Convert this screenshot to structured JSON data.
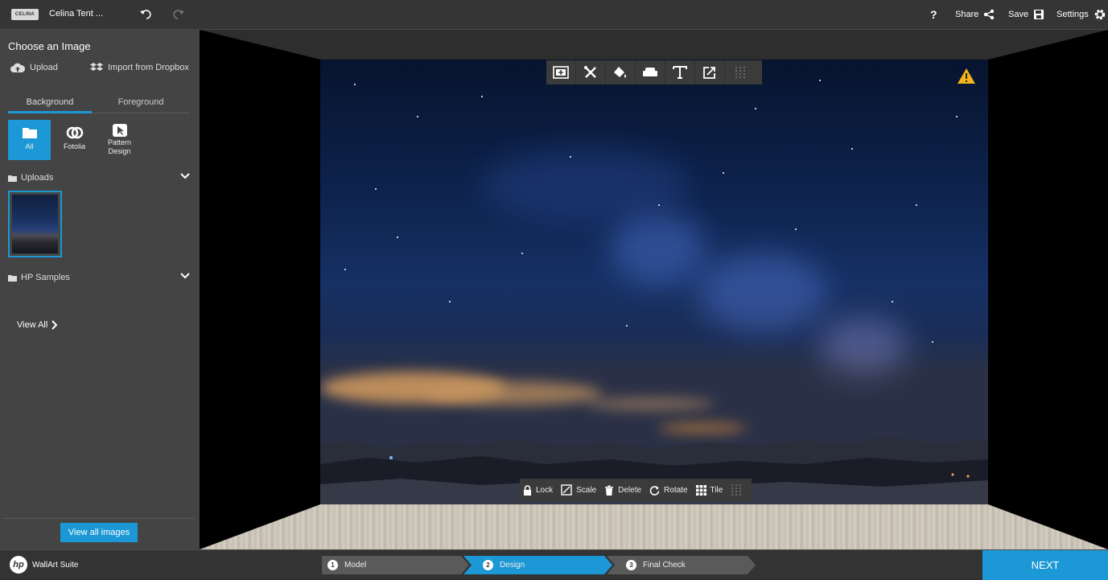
{
  "header": {
    "logo_text": "CELINA",
    "project_title": "Celina Tent ...",
    "help_label": "?",
    "share_label": "Share",
    "save_label": "Save",
    "settings_label": "Settings"
  },
  "sidebar": {
    "title": "Choose an Image",
    "upload_label": "Upload",
    "dropbox_label": "Import from Dropbox",
    "tabs": [
      {
        "label": "Background",
        "active": true
      },
      {
        "label": "Foreground",
        "active": false
      }
    ],
    "categories": [
      {
        "label": "All",
        "active": true,
        "icon": "folder-icon"
      },
      {
        "label": "Fotolia",
        "active": false,
        "icon": "fotolia-icon"
      },
      {
        "label": "Pattern Design",
        "active": false,
        "icon": "pattern-icon"
      }
    ],
    "sections": [
      {
        "label": "Uploads",
        "expanded": true
      },
      {
        "label": "HP Samples",
        "expanded": false
      }
    ],
    "view_all_label": "View All",
    "view_all_images_label": "View all images"
  },
  "canvas": {
    "toolbar_top": [
      "add-image-icon",
      "tools-icon",
      "fill-icon",
      "furniture-icon",
      "text-icon",
      "export-icon",
      "drag-handle-icon"
    ],
    "toolbar_bottom": [
      {
        "label": "Lock",
        "icon": "lock-icon"
      },
      {
        "label": "Scale",
        "icon": "scale-icon"
      },
      {
        "label": "Delete",
        "icon": "trash-icon"
      },
      {
        "label": "Rotate",
        "icon": "rotate-icon"
      },
      {
        "label": "Tile",
        "icon": "tile-icon"
      }
    ],
    "warning_icon": "warning-icon"
  },
  "footer": {
    "logo_text": "hp",
    "brand": "WallArt Suite",
    "steps": [
      {
        "num": "1",
        "label": "Model",
        "active": false
      },
      {
        "num": "2",
        "label": "Design",
        "active": true
      },
      {
        "num": "3",
        "label": "Final Check",
        "active": false
      }
    ],
    "next_label": "NEXT"
  },
  "colors": {
    "accent": "#1b98d5",
    "warning": "#f3b41b",
    "sidebar": "#444444",
    "header": "#353535"
  }
}
